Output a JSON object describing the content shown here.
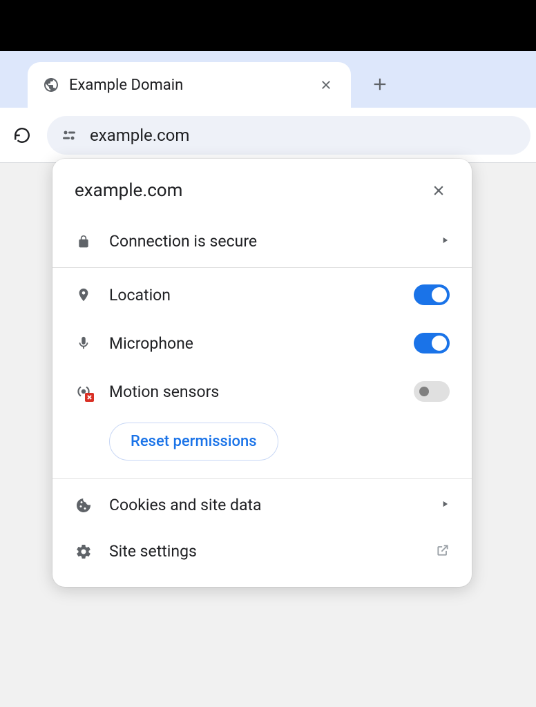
{
  "tab": {
    "title": "Example Domain"
  },
  "address_bar": {
    "url": "example.com"
  },
  "popup": {
    "title": "example.com",
    "connection_secure": "Connection is secure",
    "permissions": {
      "location": {
        "label": "Location",
        "enabled": true
      },
      "microphone": {
        "label": "Microphone",
        "enabled": true
      },
      "motion_sensors": {
        "label": "Motion sensors",
        "enabled": false
      }
    },
    "reset_button": "Reset permissions",
    "cookies": "Cookies and site data",
    "site_settings": "Site settings"
  },
  "colors": {
    "accent": "#1a73e8",
    "tab_strip_bg": "#dde7fb"
  }
}
